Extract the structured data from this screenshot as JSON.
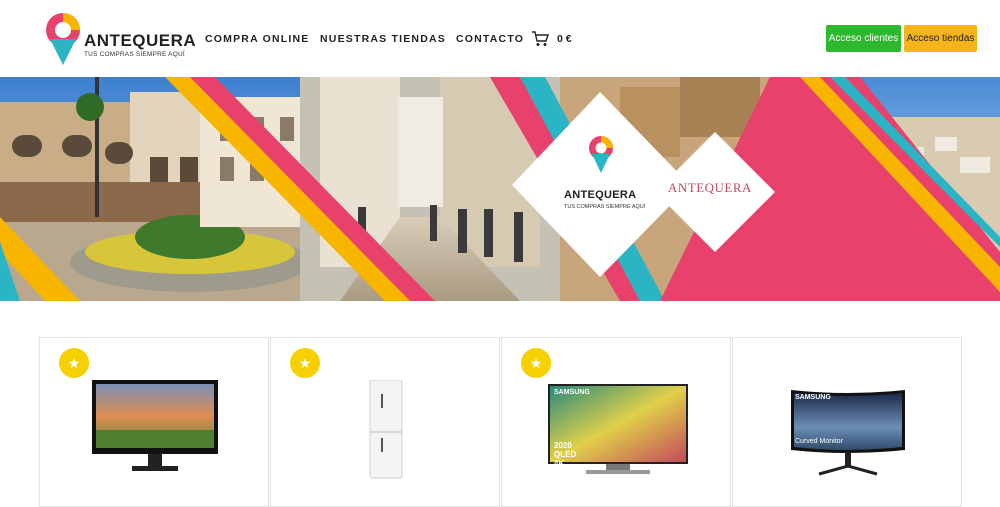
{
  "brand": {
    "name": "ANTEQUERA",
    "tagline": "TUS COMPRAS SIEMPRE AQUÍ"
  },
  "nav": {
    "items": [
      {
        "label": "COMPRA ONLINE"
      },
      {
        "label": "NUESTRAS TIENDAS"
      },
      {
        "label": "CONTACTO"
      }
    ]
  },
  "cart": {
    "icon": "shopping-cart-icon",
    "amount": "0 €"
  },
  "buttons": {
    "clients": "Acceso clientes",
    "stores": "Acceso tiendas"
  },
  "banner": {
    "card_brand": "ANTEQUERA",
    "card_tagline": "TUS COMPRAS SIEMPRE AQUÍ",
    "secondary_brand": "ANTEQUERA"
  },
  "products": [
    {
      "type": "monitor",
      "featured": true
    },
    {
      "type": "fridge",
      "featured": true
    },
    {
      "type": "tv",
      "featured": true,
      "screen_text": "2020 QLED 4K",
      "brand": "SAMSUNG"
    },
    {
      "type": "curved-monitor",
      "featured": false,
      "brand": "SAMSUNG",
      "screen_text": "Curved Monitor"
    }
  ],
  "colors": {
    "pink": "#e8416c",
    "yellow": "#f7b500",
    "teal": "#2bb4c4",
    "green": "#2eb82e",
    "orange": "#f4b41a"
  }
}
